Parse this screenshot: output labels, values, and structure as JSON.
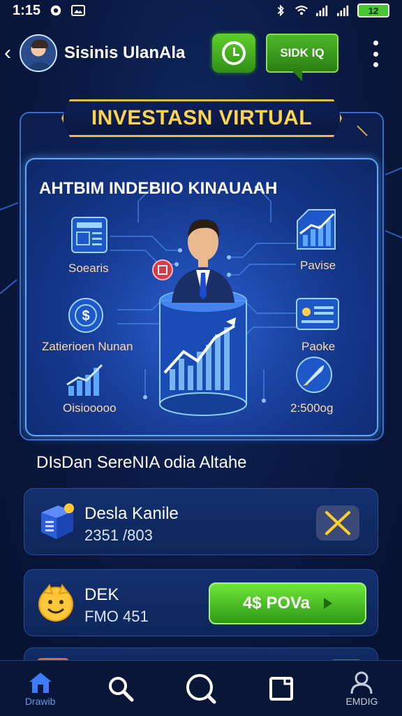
{
  "status_bar": {
    "time": "1:15",
    "battery": "12"
  },
  "header": {
    "user_name": "Sisinis UlanAla",
    "chat_button_label": "SIDK IQ"
  },
  "banner": {
    "title": "INVESTASN VIRTUAL"
  },
  "hero": {
    "title": "AHTBIM INDEBIIO KINAUAAH",
    "features": [
      {
        "label": "Soearis",
        "icon": "document-icon"
      },
      {
        "label": "Zatierioen Nunan",
        "icon": "dollar-coin-icon"
      },
      {
        "label": "Oisiooooo",
        "icon": "bar-growth-icon"
      },
      {
        "label": "Pavise",
        "icon": "chart-up-icon"
      },
      {
        "label": "Paoke",
        "icon": "id-card-icon"
      },
      {
        "label": "2:500og",
        "icon": "rocket-icon"
      }
    ]
  },
  "section": {
    "title": "DIsDan SereNIA odia Altahe"
  },
  "cards": [
    {
      "name": "Desla Kanile",
      "sub": "2351 /803",
      "icon": "package-box-icon",
      "action": "close-icon"
    },
    {
      "name": "DEK",
      "sub": "FMO 451",
      "icon": "smiley-face-icon",
      "button_label": "4$ POVa"
    }
  ],
  "bottom_nav": [
    {
      "label": "Drawib",
      "icon": "home-icon"
    },
    {
      "label": "",
      "icon": "search-icon"
    },
    {
      "label": "",
      "icon": "search-circle-icon"
    },
    {
      "label": "",
      "icon": "square-icon"
    },
    {
      "label": "EMDIG",
      "icon": "user-icon"
    }
  ],
  "colors": {
    "accent_green": "#4db82a",
    "banner_gold": "#e8b94a",
    "panel_blue": "#5ba8ff",
    "background": "#0a1a44"
  }
}
